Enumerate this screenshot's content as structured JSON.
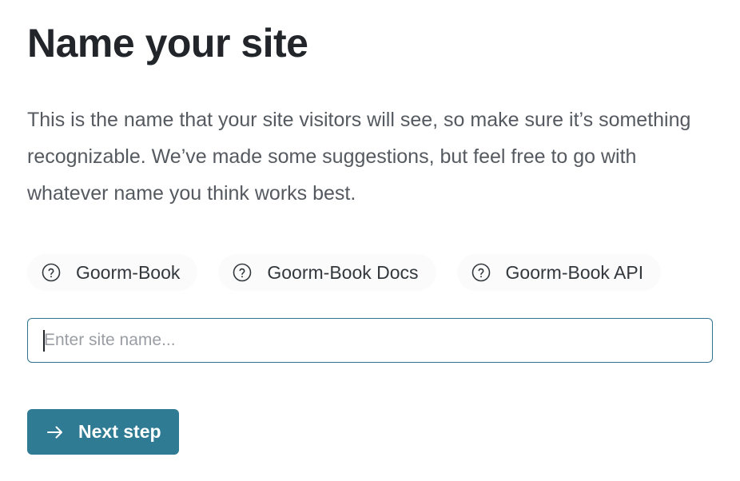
{
  "heading": "Name your site",
  "description": "This is the name that your site visitors will see, so make sure it’s something recognizable. We’ve made some suggestions, but feel free to go with whatever name you think works best.",
  "suggestions": [
    {
      "label": "Goorm-Book",
      "icon": "question-circle-icon"
    },
    {
      "label": "Goorm-Book Docs",
      "icon": "question-circle-icon"
    },
    {
      "label": "Goorm-Book API",
      "icon": "question-circle-icon"
    }
  ],
  "site_name_input": {
    "placeholder": "Enter site name...",
    "value": ""
  },
  "next_button": {
    "label": "Next step",
    "icon": "arrow-right-icon"
  },
  "colors": {
    "accent": "#2f7b93",
    "input_border": "#2e7590",
    "heading": "#22262b",
    "body_text": "#555a60"
  }
}
